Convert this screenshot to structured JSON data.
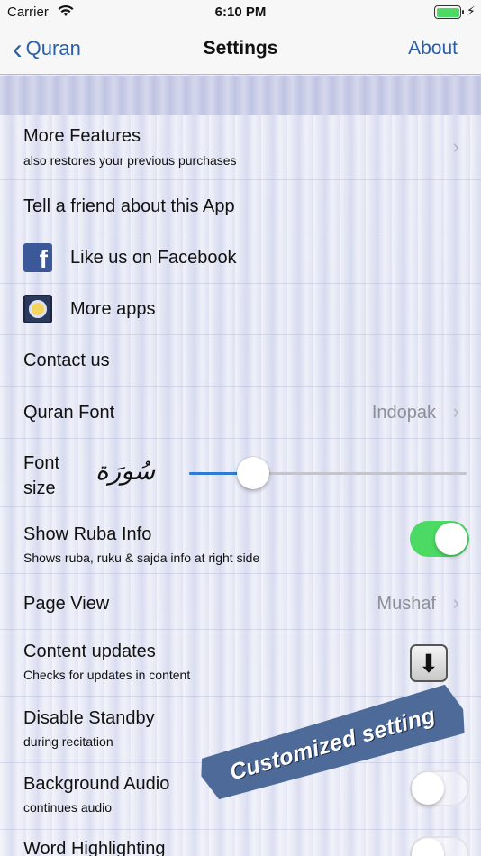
{
  "status_bar": {
    "carrier": "Carrier",
    "time": "6:10 PM"
  },
  "nav": {
    "back_label": "Quran",
    "title": "Settings",
    "about_label": "About"
  },
  "rows": {
    "more_features": {
      "title": "More Features",
      "subtitle": "also restores your previous purchases"
    },
    "tell_friend": {
      "title": "Tell a friend about this App"
    },
    "facebook": {
      "title": "Like us on Facebook"
    },
    "more_apps": {
      "title": "More apps"
    },
    "contact": {
      "title": "Contact us"
    },
    "quran_font": {
      "title": "Quran Font",
      "value": "Indopak"
    },
    "font_size": {
      "title_line1": "Font",
      "title_line2": "size",
      "sample": "سُورَة",
      "level": 0.23
    },
    "ruba_info": {
      "title": "Show Ruba Info",
      "subtitle": "Shows ruba, ruku & sajda info at right side",
      "enabled": true
    },
    "page_view": {
      "title": "Page View",
      "value": "Mushaf"
    },
    "content_updates": {
      "title": "Content updates",
      "subtitle": "Checks for updates in content"
    },
    "disable_standby": {
      "title": "Disable Standby",
      "subtitle": "during recitation"
    },
    "background_audio": {
      "title": "Background Audio",
      "subtitle": "continues audio",
      "enabled": false
    },
    "word_highlighting": {
      "title": "Word Highlighting",
      "enabled": false
    }
  },
  "banner": {
    "text": "Customized setting"
  },
  "colors": {
    "accent": "#2a5fa6",
    "toggle_on": "#4cd964",
    "slider": "#2f7ad4",
    "banner": "#4d6a98"
  }
}
